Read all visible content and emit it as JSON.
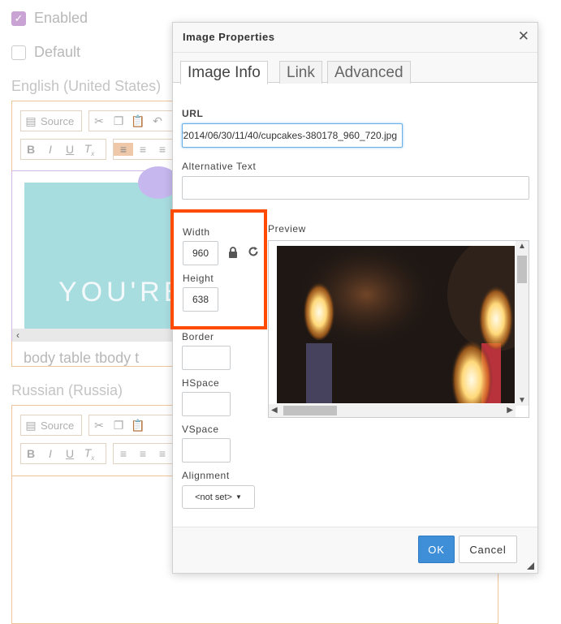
{
  "background": {
    "enabled_label": "Enabled",
    "enabled_checked": true,
    "default_label": "Default",
    "default_checked": false,
    "english_label": "English (United States)",
    "russian_label": "Russian (Russia)",
    "source_label": "Source",
    "image_text": "YOU'RE",
    "path_bar": "body  table  tbody  t"
  },
  "dialog": {
    "title": "Image Properties",
    "close_label": "✕",
    "tabs": [
      {
        "label": "Image Info",
        "active": true
      },
      {
        "label": "Link",
        "active": false
      },
      {
        "label": "Advanced",
        "active": false
      }
    ],
    "url_label": "URL",
    "url_value": "/2014/06/30/11/40/cupcakes-380178_960_720.jpg",
    "alt_label": "Alternative Text",
    "alt_value": "",
    "width_label": "Width",
    "width_value": "960",
    "height_label": "Height",
    "height_value": "638",
    "border_label": "Border",
    "hspace_label": "HSpace",
    "vspace_label": "VSpace",
    "alignment_label": "Alignment",
    "alignment_value": "<not set>",
    "preview_label": "Preview",
    "ok_label": "OK",
    "cancel_label": "Cancel"
  },
  "colors": {
    "highlight": "#ff4b00",
    "ok_button": "#3f8fd8",
    "editor_border": "#eec49a"
  },
  "icons": {
    "lock": "lock-icon",
    "reset": "reset-size-icon",
    "close": "close-icon"
  }
}
